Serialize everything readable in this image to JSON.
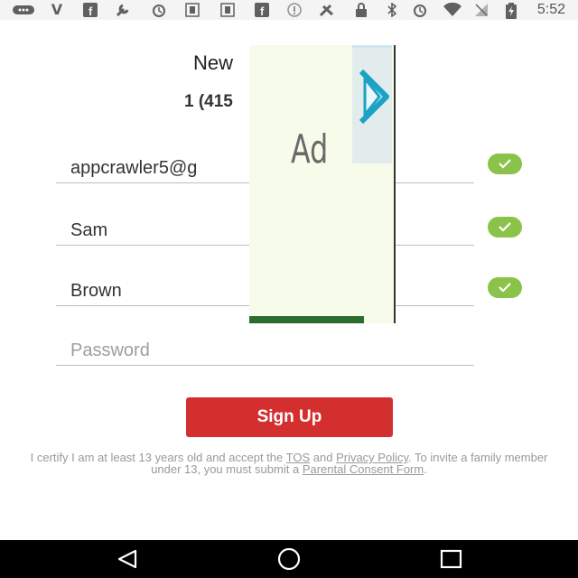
{
  "status_bar": {
    "time": "5:52",
    "icons": [
      "message-icon",
      "v-icon",
      "facebook-icon",
      "wrench-icon",
      "alarm-icon",
      "app-icon",
      "app-icon",
      "facebook-icon",
      "info-icon",
      "phone-fax-icon",
      "lock-icon",
      "bluetooth-icon",
      "alarm-icon",
      "wifi-icon",
      "no-sim-icon",
      "battery-charging-icon"
    ]
  },
  "header": {
    "title": "New",
    "subtitle": "1 (415"
  },
  "form": {
    "email_value": "appcrawler5@g",
    "first_name_value": "Sam",
    "last_name_value": "Brown",
    "password_placeholder": "Password"
  },
  "ad": {
    "label": "Ad"
  },
  "signup_button": {
    "label": "Sign Up"
  },
  "legal": {
    "text_1": "I certify I am at least 13 years old and accept the ",
    "tos": "TOS",
    "and": " and ",
    "privacy": "Privacy Policy",
    "text_2": ". To invite a family member under 13, you must submit a ",
    "parental": "Parental Consent Form",
    "end": "."
  },
  "colors": {
    "accent": "#d32f2f",
    "check": "#8bc34a"
  },
  "nav": {
    "back": "back-icon",
    "home": "home-icon",
    "recents": "recents-icon"
  }
}
